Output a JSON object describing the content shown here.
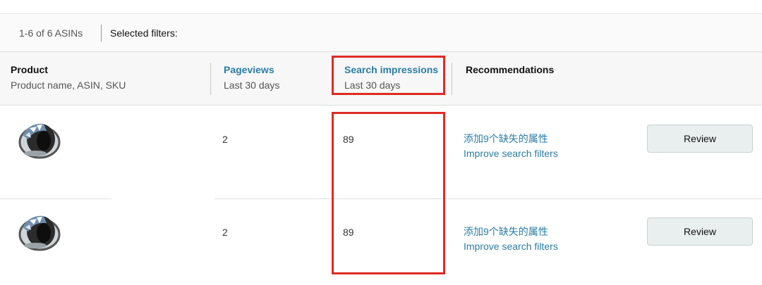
{
  "summary": {
    "count_text": "1-6 of 6 ASINs",
    "filters_label": "Selected filters:"
  },
  "columns": {
    "product": {
      "title": "Product",
      "subtitle": "Product name, ASIN, SKU"
    },
    "pageviews": {
      "title": "Pageviews",
      "subtitle": "Last 30 days"
    },
    "impressions": {
      "title": "Search impressions",
      "subtitle": "Last 30 days"
    },
    "recommendations": {
      "title": "Recommendations"
    }
  },
  "rows": [
    {
      "pageviews": "2",
      "impressions": "89",
      "rec_line1": "添加9个缺失的属性",
      "rec_line2": "Improve search filters",
      "action": "Review"
    },
    {
      "pageviews": "2",
      "impressions": "89",
      "rec_line1": "添加9个缺失的属性",
      "rec_line2": "Improve search filters",
      "action": "Review"
    }
  ],
  "colors": {
    "link": "#2a7da8",
    "highlight": "#e02b23",
    "button_bg": "#e9eeef"
  },
  "icons": {
    "product_image": "bracelet-image"
  }
}
